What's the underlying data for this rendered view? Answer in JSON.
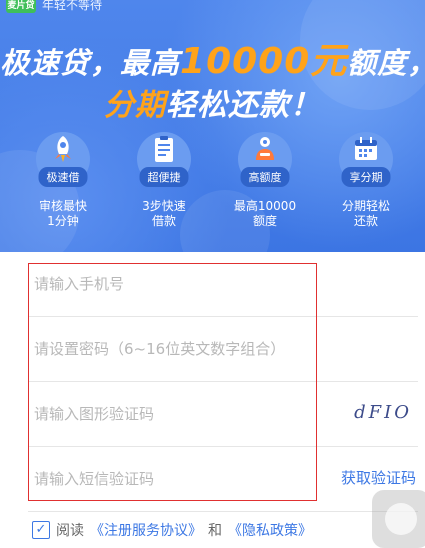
{
  "banner": {
    "logo_badge": "麦片贷",
    "logo_text": "年轻不等待",
    "headline_line1_a": "极速贷，最高",
    "headline_amount": "10000元",
    "headline_line1_b": "额度，",
    "headline_line2_highlight": "分期",
    "headline_line2_rest": "轻松还款！",
    "features": [
      {
        "pill": "极速借",
        "desc": "审核最快\n1分钟",
        "icon": "rocket-icon"
      },
      {
        "pill": "超便捷",
        "desc": "3步快速\n借款",
        "icon": "clipboard-icon"
      },
      {
        "pill": "高额度",
        "desc": "最高10000\n额度",
        "icon": "money-bag-icon"
      },
      {
        "pill": "享分期",
        "desc": "分期轻松\n还款",
        "icon": "calendar-icon"
      }
    ],
    "colors": {
      "accent": "#ffa31a",
      "banner": "#4f86ec"
    }
  },
  "form": {
    "phone": {
      "placeholder": "请输入手机号",
      "value": ""
    },
    "password": {
      "placeholder": "请设置密码（6~16位英文数字组合）",
      "value": ""
    },
    "captcha": {
      "placeholder": "请输入图形验证码",
      "value": "",
      "image_text": "dFIO"
    },
    "sms": {
      "placeholder": "请输入短信验证码",
      "value": "",
      "button_label": "获取验证码"
    }
  },
  "agreement": {
    "checked": true,
    "check_mark": "✓",
    "prefix": "阅读",
    "link1": "《注册服务协议》",
    "mid": "和",
    "link2": "《隐私政策》"
  },
  "link_color": "#3d78e4"
}
